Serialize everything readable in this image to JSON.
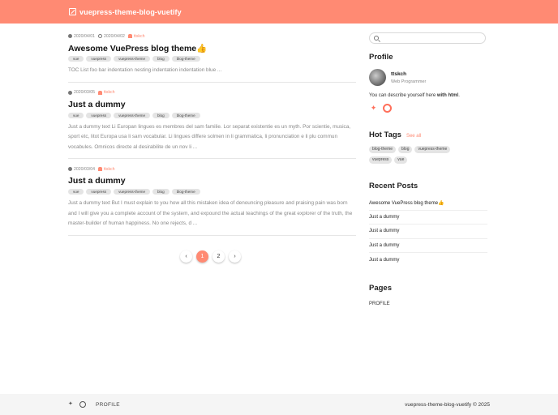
{
  "appbar": {
    "title": "vuepress-theme-blog-vuetify"
  },
  "posts": [
    {
      "created": "2020/04/01",
      "updated": "2020/04/02",
      "author": "ttskch",
      "title": "Awesome VuePress blog theme👍",
      "tags": [
        "vue",
        "vuepress",
        "vuepress-theme",
        "blog",
        "blog-theme"
      ],
      "excerpt": "TOC List foo bar indentation nesting indentation indentation blue ..."
    },
    {
      "created": "2020/03/05",
      "author": "ttskch",
      "title": "Just a dummy",
      "tags": [
        "vue",
        "vuepress",
        "vuepress-theme",
        "blog",
        "blog-theme"
      ],
      "excerpt": "Just a dummy text Li Europan lingues es membres del sam familie. Lor separat existentie es un myth. Por scientie, musica, sport etc, litot Europa usa li sam vocabular. Li lingues differe solmen in li grammatica, li pronunciation e li plu commun vocabules. Omnicos directe al desirabilite de un nov li ..."
    },
    {
      "created": "2020/03/04",
      "author": "ttskch",
      "title": "Just a dummy",
      "tags": [
        "vue",
        "vuepress",
        "vuepress-theme",
        "blog",
        "blog-theme"
      ],
      "excerpt": "Just a dummy text But I must explain to you how all this mistaken idea of denouncing pleasure and praising pain was born and I will give you a complete account of the system, and expound the actual teachings of the great explorer of the truth, the master-builder of human happiness. No one rejects, d ..."
    }
  ],
  "pagination": {
    "prev": "‹",
    "pages": [
      "1",
      "2"
    ],
    "current": "1",
    "next": "›"
  },
  "sidebar": {
    "search": {
      "value": "",
      "placeholder": ""
    },
    "profile": {
      "title": "Profile",
      "name": "ttskch",
      "role": "Web Programmer",
      "desc_prefix": "You can describe yourself here ",
      "desc_bold": "with html",
      "desc_suffix": "."
    },
    "hot_tags": {
      "title": "Hot Tags",
      "see_all": "See all",
      "tags": [
        "blog-theme",
        "blog",
        "vuepress-theme",
        "vuepress",
        "vue"
      ]
    },
    "recent": {
      "title": "Recent Posts",
      "items": [
        "Awesome VuePress blog theme👍",
        "Just a dummy",
        "Just a dummy",
        "Just a dummy",
        "Just a dummy"
      ]
    },
    "pages": {
      "title": "Pages",
      "items": [
        "PROFILE"
      ]
    }
  },
  "footer": {
    "link": "PROFILE",
    "copyright": "vuepress-theme-blog-vuetify © 2025"
  },
  "colors": {
    "accent": "#ff8a73",
    "footer_bg": "#f5f5f5"
  },
  "icons": {
    "twitter": "twitter-icon",
    "github": "github-icon"
  }
}
